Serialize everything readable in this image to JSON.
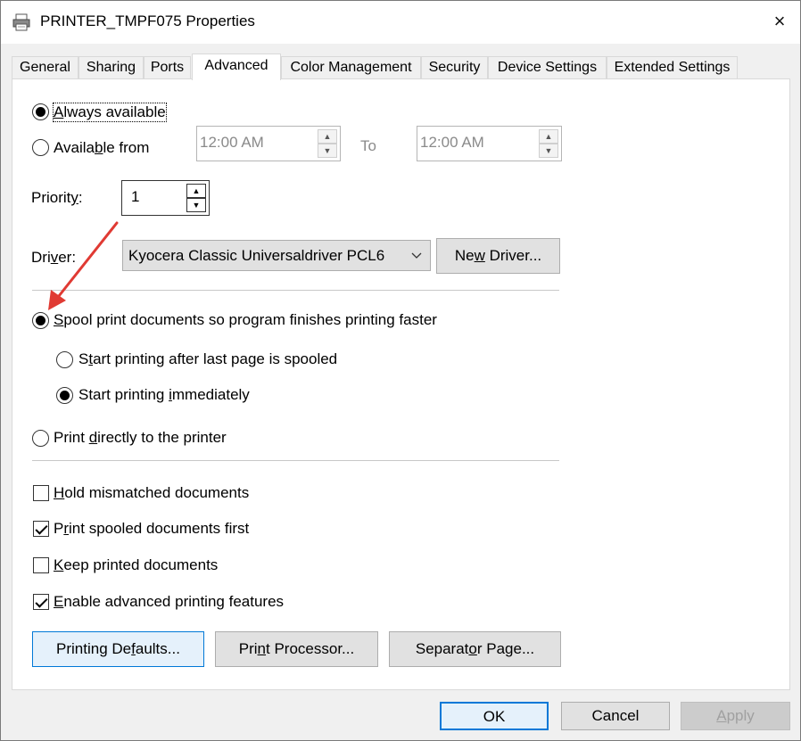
{
  "window": {
    "title": "PRINTER_TMPF075 Properties",
    "close_icon": "×"
  },
  "tabs": [
    {
      "label": "General",
      "active": false
    },
    {
      "label": "Sharing",
      "active": false
    },
    {
      "label": "Ports",
      "active": false
    },
    {
      "label": "Advanced",
      "active": true
    },
    {
      "label": "Color Management",
      "active": false
    },
    {
      "label": "Security",
      "active": false
    },
    {
      "label": "Device Settings",
      "active": false
    },
    {
      "label": "Extended Settings",
      "active": false
    }
  ],
  "availability": {
    "always_label_pre": "",
    "always_label_u": "A",
    "always_label_post": "lways available",
    "from_label_pre": "Availa",
    "from_label_u": "b",
    "from_label_post": "le from",
    "from_time": "12:00 AM",
    "to_label": "To",
    "to_time": "12:00 AM"
  },
  "priority": {
    "label_pre": "Priorit",
    "label_u": "y",
    "label_post": ":",
    "value": "1"
  },
  "driver": {
    "label_pre": "Dri",
    "label_u": "v",
    "label_post": "er:",
    "selected": "Kyocera Classic Universaldriver PCL6",
    "new_driver_pre": "Ne",
    "new_driver_u": "w",
    "new_driver_post": " Driver..."
  },
  "spooling": {
    "spool_pre": "",
    "spool_u": "S",
    "spool_post": "pool print documents so program finishes printing faster",
    "after_last_pre": "S",
    "after_last_u": "t",
    "after_last_post": "art printing after last page is spooled",
    "immediately_pre": "Start printing ",
    "immediately_u": "i",
    "immediately_post": "mmediately",
    "direct_pre": "Print ",
    "direct_u": "d",
    "direct_post": "irectly to the printer"
  },
  "options": {
    "hold_pre": "",
    "hold_u": "H",
    "hold_post": "old mismatched documents",
    "hold_checked": false,
    "spooled_first_pre": "P",
    "spooled_first_u": "r",
    "spooled_first_post": "int spooled documents first",
    "spooled_first_checked": true,
    "keep_pre": "",
    "keep_u": "K",
    "keep_post": "eep printed documents",
    "keep_checked": false,
    "advanced_pre": "",
    "advanced_u": "E",
    "advanced_post": "nable advanced printing features",
    "advanced_checked": true
  },
  "panel_buttons": {
    "defaults_pre": "Printing De",
    "defaults_u": "f",
    "defaults_post": "aults...",
    "processor_pre": "Pri",
    "processor_u": "n",
    "processor_post": "t Processor...",
    "separator_pre": "Separat",
    "separator_u": "o",
    "separator_post": "r Page..."
  },
  "dialog_buttons": {
    "ok": "OK",
    "cancel": "Cancel",
    "apply_pre": "",
    "apply_u": "A",
    "apply_post": "pply"
  },
  "colors": {
    "annotation_arrow": "#e03a33",
    "accent": "#0078d7"
  }
}
